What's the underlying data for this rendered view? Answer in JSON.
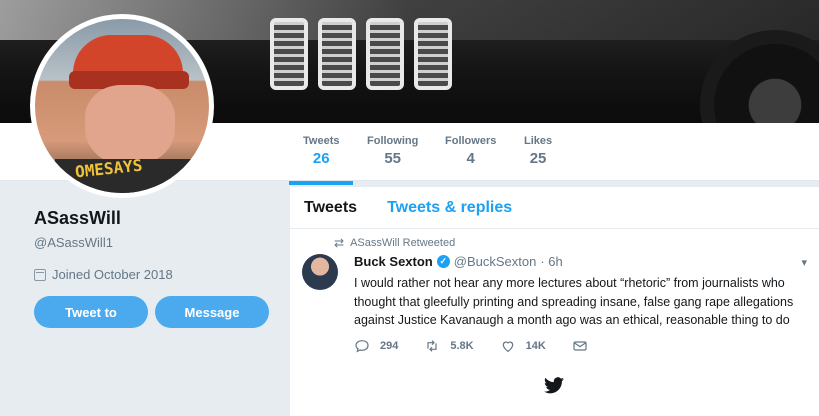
{
  "profile": {
    "name": "ASassWill",
    "handle": "@ASassWill1",
    "joined": "Joined October 2018",
    "avatar_shirt_text": "OMESAYS",
    "buttons": {
      "tweet_to": "Tweet to",
      "message": "Message"
    }
  },
  "stats": [
    {
      "label": "Tweets",
      "value": "26"
    },
    {
      "label": "Following",
      "value": "55"
    },
    {
      "label": "Followers",
      "value": "4"
    },
    {
      "label": "Likes",
      "value": "25"
    }
  ],
  "tabs": {
    "tweets": "Tweets",
    "replies": "Tweets & replies"
  },
  "tweet": {
    "retweet_context": "ASassWill Retweeted",
    "author_name": "Buck Sexton",
    "author_handle": "@BuckSexton",
    "time": "· 6h",
    "text": "I would rather not hear any more lectures about “rhetoric” from journalists who thought that gleefully printing and spreading insane, false gang rape allegations against Justice Kavanaugh a month ago was an ethical, reasonable thing to do",
    "replies": "294",
    "retweets": "5.8K",
    "likes": "14K"
  },
  "colors": {
    "accent": "#1da1f2",
    "button": "#4aaaed",
    "muted": "#657786",
    "bg": "#e6ecf0"
  },
  "icons": [
    "calendar-icon",
    "retweet-icon",
    "verified-icon",
    "caret-down-icon",
    "reply-icon",
    "like-icon",
    "message-icon",
    "twitter-bird-icon"
  ]
}
